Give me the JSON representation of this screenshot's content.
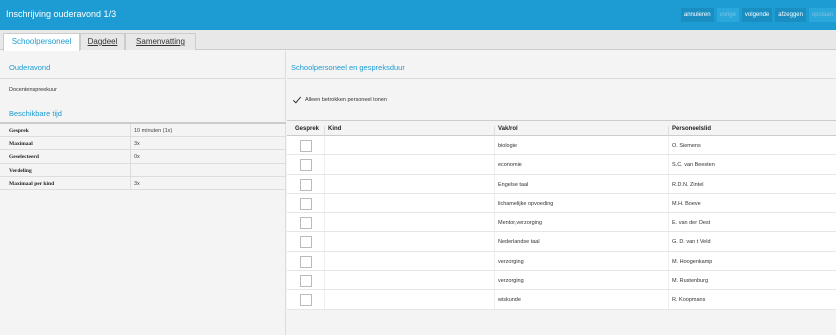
{
  "window": {
    "title": "Inschrijving ouderavond 1/3"
  },
  "toolbar": {
    "actions": [
      {
        "label": "annuleren",
        "disabled": false
      },
      {
        "label": "vorige",
        "disabled": true
      },
      {
        "label": "volgende",
        "disabled": false
      },
      {
        "label": "afzeggen",
        "disabled": false
      },
      {
        "label": "opslaan",
        "disabled": true
      }
    ]
  },
  "tabs": [
    {
      "label": "Schoolpersoneel",
      "active": true
    },
    {
      "label": "Dagdeel",
      "active": false
    },
    {
      "label": "Samenvatting",
      "active": false
    }
  ],
  "left": {
    "ouderavond_title": "Ouderavond",
    "ouderavond_name": "Docentenspreekuur",
    "beschikbare_title": "Beschikbare tijd",
    "rows": [
      {
        "key": "Gesprek",
        "value": "10 minuten (1x)"
      },
      {
        "key": "Maximaal",
        "value": "3x"
      },
      {
        "key": "Geselecteerd",
        "value": "0x"
      },
      {
        "key": "Verdeling",
        "value": ""
      },
      {
        "key": "Maximaal per kind",
        "value": "3x"
      }
    ]
  },
  "right": {
    "title": "Schoolpersoneel en gespreksduur",
    "checkbox_label": "Alleen betrokken personeel tonen",
    "checkbox_checked": true,
    "columns": {
      "gesprek": "Gesprek",
      "kind": "Kind",
      "vak": "Vak/rol",
      "personeel": "Personeelslid"
    },
    "rows": [
      {
        "kind": "",
        "vak": "biologie",
        "personeel": "O. Siemens"
      },
      {
        "kind": "",
        "vak": "economie",
        "personeel": "S.C. van Beesten"
      },
      {
        "kind": "",
        "vak": "Engelse taal",
        "personeel": "R.D.N. Zintel"
      },
      {
        "kind": "",
        "vak": "lichamelijke opvoeding",
        "personeel": "M.H. Boeve"
      },
      {
        "kind": "",
        "vak": "Mentor,verzorging",
        "personeel": "E. van der Oest"
      },
      {
        "kind": "",
        "vak": "Nederlandse taal",
        "personeel": "G. D. van t Veld"
      },
      {
        "kind": "",
        "vak": "verzorging",
        "personeel": "M. Hoogenkamp"
      },
      {
        "kind": "",
        "vak": "verzorging",
        "personeel": "M. Rustenburg"
      },
      {
        "kind": "",
        "vak": "wiskunde",
        "personeel": "R. Koopmans"
      }
    ]
  }
}
